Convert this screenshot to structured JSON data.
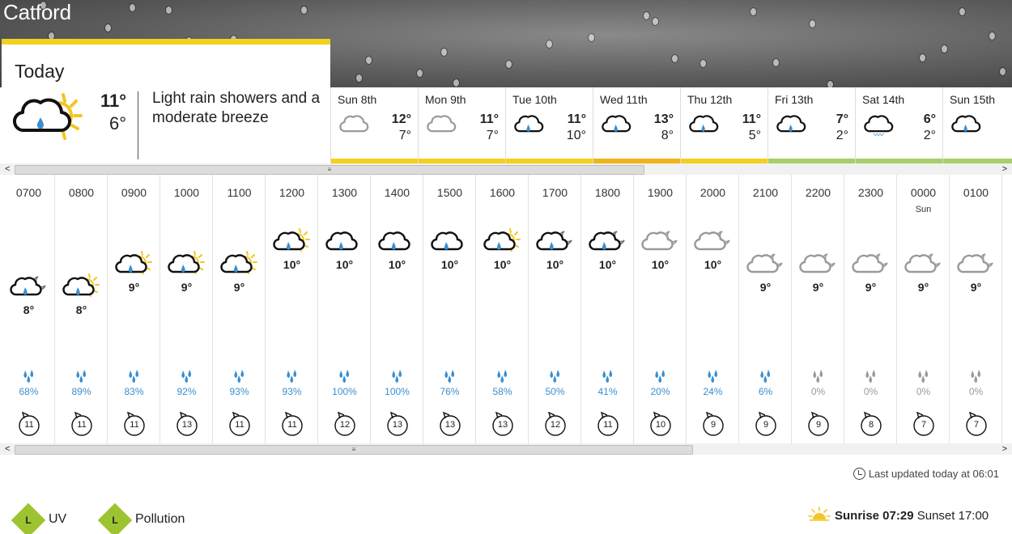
{
  "location": "Catford",
  "today": {
    "label": "Today",
    "icon": "light-rain-sun-icon",
    "high": "11°",
    "low": "6°",
    "description": "Light rain showers and a moderate breeze"
  },
  "days": [
    {
      "name": "Sun 8th",
      "icon": "cloud-icon",
      "high": "12°",
      "low": "7°",
      "bar": "#f3d01d"
    },
    {
      "name": "Mon 9th",
      "icon": "cloud-icon",
      "high": "11°",
      "low": "7°",
      "bar": "#f3d01d"
    },
    {
      "name": "Tue 10th",
      "icon": "rain-cloud-icon",
      "high": "11°",
      "low": "10°",
      "bar": "#f3d01d"
    },
    {
      "name": "Wed 11th",
      "icon": "rain-cloud-icon",
      "high": "13°",
      "low": "8°",
      "bar": "#f0b419"
    },
    {
      "name": "Thu 12th",
      "icon": "rain-cloud-icon",
      "high": "11°",
      "low": "5°",
      "bar": "#f3d01d"
    },
    {
      "name": "Fri 13th",
      "icon": "rain-cloud-icon",
      "high": "7°",
      "low": "2°",
      "bar": "#a7cf6a"
    },
    {
      "name": "Sat 14th",
      "icon": "sleet-cloud-icon",
      "high": "6°",
      "low": "2°",
      "bar": "#a7cf6a"
    },
    {
      "name": "Sun 15th",
      "icon": "rain-cloud-icon",
      "high": "",
      "low": "",
      "bar": "#a7cf6a"
    }
  ],
  "hours": [
    {
      "time": "0700",
      "day": "",
      "icon": "rain-moon-icon",
      "temp": "8°",
      "rain": "68%",
      "rain_icon": "blue",
      "wind": "11"
    },
    {
      "time": "0800",
      "day": "",
      "icon": "rain-sun-icon",
      "temp": "8°",
      "rain": "89%",
      "rain_icon": "blue",
      "wind": "11"
    },
    {
      "time": "0900",
      "day": "",
      "icon": "rain-sun-icon",
      "temp": "9°",
      "rain": "83%",
      "rain_icon": "blue",
      "wind": "11"
    },
    {
      "time": "1000",
      "day": "",
      "icon": "rain-sun-icon",
      "temp": "9°",
      "rain": "92%",
      "rain_icon": "blue",
      "wind": "13"
    },
    {
      "time": "1100",
      "day": "",
      "icon": "rain-sun-icon",
      "temp": "9°",
      "rain": "93%",
      "rain_icon": "blue",
      "wind": "11"
    },
    {
      "time": "1200",
      "day": "",
      "icon": "rain-sun-icon",
      "temp": "10°",
      "rain": "93%",
      "rain_icon": "blue",
      "wind": "11"
    },
    {
      "time": "1300",
      "day": "",
      "icon": "rain-cloud-icon",
      "temp": "10°",
      "rain": "100%",
      "rain_icon": "blue",
      "wind": "12"
    },
    {
      "time": "1400",
      "day": "",
      "icon": "rain-cloud-icon",
      "temp": "10°",
      "rain": "100%",
      "rain_icon": "blue",
      "wind": "13"
    },
    {
      "time": "1500",
      "day": "",
      "icon": "rain-cloud-icon",
      "temp": "10°",
      "rain": "76%",
      "rain_icon": "blue",
      "wind": "13"
    },
    {
      "time": "1600",
      "day": "",
      "icon": "rain-sun-icon",
      "temp": "10°",
      "rain": "58%",
      "rain_icon": "blue",
      "wind": "13"
    },
    {
      "time": "1700",
      "day": "",
      "icon": "rain-moon-icon",
      "temp": "10°",
      "rain": "50%",
      "rain_icon": "blue",
      "wind": "12"
    },
    {
      "time": "1800",
      "day": "",
      "icon": "rain-moon-icon",
      "temp": "10°",
      "rain": "41%",
      "rain_icon": "blue",
      "wind": "11"
    },
    {
      "time": "1900",
      "day": "",
      "icon": "cloud-moon-icon",
      "temp": "10°",
      "rain": "20%",
      "rain_icon": "blue",
      "wind": "10"
    },
    {
      "time": "2000",
      "day": "",
      "icon": "cloud-moon-icon",
      "temp": "10°",
      "rain": "24%",
      "rain_icon": "blue",
      "wind": "9"
    },
    {
      "time": "2100",
      "day": "",
      "icon": "cloud-moon-icon",
      "temp": "9°",
      "rain": "6%",
      "rain_icon": "blue",
      "wind": "9"
    },
    {
      "time": "2200",
      "day": "",
      "icon": "cloud-moon-icon",
      "temp": "9°",
      "rain": "0%",
      "rain_icon": "grey",
      "wind": "9"
    },
    {
      "time": "2300",
      "day": "",
      "icon": "cloud-moon-icon",
      "temp": "9°",
      "rain": "0%",
      "rain_icon": "grey",
      "wind": "8"
    },
    {
      "time": "0000",
      "day": "Sun",
      "icon": "cloud-moon-icon",
      "temp": "9°",
      "rain": "0%",
      "rain_icon": "grey",
      "wind": "7"
    },
    {
      "time": "0100",
      "day": "",
      "icon": "cloud-moon-icon",
      "temp": "9°",
      "rain": "0%",
      "rain_icon": "grey",
      "wind": "7"
    }
  ],
  "updated": "Last updated today at 06:01",
  "uv": {
    "badge": "L",
    "label": "UV"
  },
  "pollution": {
    "badge": "L",
    "label": "Pollution"
  },
  "sunrise": {
    "label": "Sunrise 07:29",
    "sunset": "Sunset 17:00"
  },
  "colors": {
    "rain_blue": "#3a8fd1",
    "rain_grey": "#999999",
    "sun_yellow": "#f3c623",
    "level_green": "#9cc431"
  }
}
